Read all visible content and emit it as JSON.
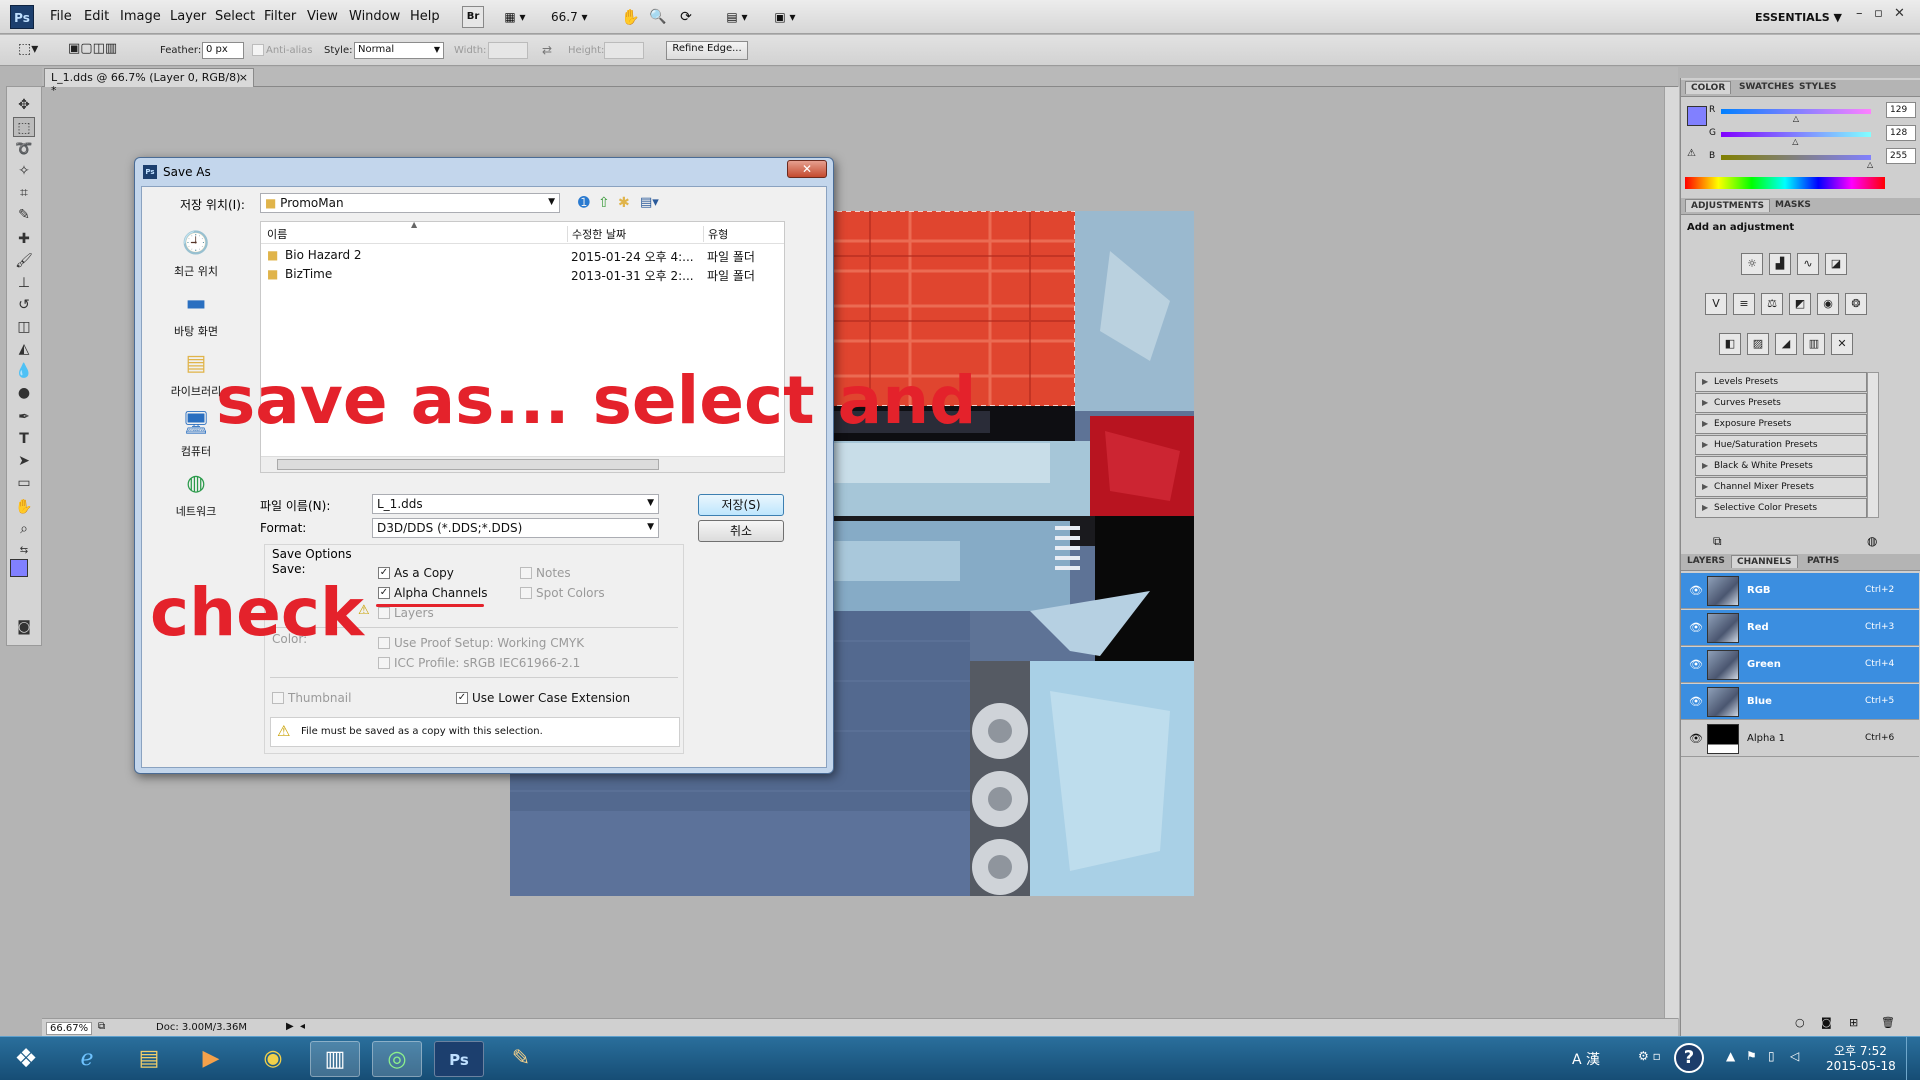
{
  "app": {
    "logo": "Ps",
    "menus": [
      "File",
      "Edit",
      "Image",
      "Layer",
      "Select",
      "Filter",
      "View",
      "Window",
      "Help"
    ],
    "bridge_button": "Br",
    "zoom_value": "66.7",
    "workspace": "ESSENTIALS",
    "workspace_arrow": "▼"
  },
  "options": {
    "feather_label": "Feather:",
    "feather_value": "0 px",
    "antialias_label": "Anti-alias",
    "style_label": "Style:",
    "style_value": "Normal",
    "width_label": "Width:",
    "height_label": "Height:",
    "refine_edge": "Refine Edge..."
  },
  "document": {
    "tab_title": "L_1.dds @ 66.7% (Layer 0, RGB/8) *",
    "tab_close": "×",
    "zoom_status": "66.67%",
    "doc_size": "Doc: 3.00M/3.36M"
  },
  "color_panel": {
    "tabs": [
      "COLOR",
      "SWATCHES",
      "STYLES"
    ],
    "channels": [
      {
        "label": "R",
        "value": "129",
        "level": 0.506
      },
      {
        "label": "G",
        "value": "128",
        "level": 0.502
      },
      {
        "label": "B",
        "value": "255",
        "level": 1.0
      }
    ],
    "fg_color": "#8180ff"
  },
  "adjustments_panel": {
    "tabs": [
      "ADJUSTMENTS",
      "MASKS"
    ],
    "heading": "Add an adjustment",
    "presets": [
      "Levels Presets",
      "Curves Presets",
      "Exposure Presets",
      "Hue/Saturation Presets",
      "Black & White Presets",
      "Channel Mixer Presets",
      "Selective Color Presets"
    ]
  },
  "channels_panel": {
    "tabs": [
      "LAYERS",
      "CHANNELS",
      "PATHS"
    ],
    "rows": [
      {
        "name": "RGB",
        "key": "Ctrl+2",
        "selected": true
      },
      {
        "name": "Red",
        "key": "Ctrl+3",
        "selected": true
      },
      {
        "name": "Green",
        "key": "Ctrl+4",
        "selected": true
      },
      {
        "name": "Blue",
        "key": "Ctrl+5",
        "selected": true
      },
      {
        "name": "Alpha 1",
        "key": "Ctrl+6",
        "selected": false
      }
    ]
  },
  "dialog": {
    "title": "Save As",
    "save_in_label": "저장 위치(I):",
    "save_in_value": "PromoMan",
    "places": [
      "최근 위치",
      "바탕 화면",
      "라이브러리",
      "컴퓨터",
      "네트워크"
    ],
    "columns": [
      "이름",
      "수정한 날짜",
      "유형"
    ],
    "files": [
      {
        "name": "Bio Hazard 2",
        "date": "2015-01-24 오후 4:...",
        "type": "파일 폴더"
      },
      {
        "name": "BizTime",
        "date": "2013-01-31 오후 2:...",
        "type": "파일 폴더"
      }
    ],
    "filename_label": "파일 이름(N):",
    "filename_value": "L_1.dds",
    "format_label": "Format:",
    "format_value": "D3D/DDS (*.DDS;*.DDS)",
    "save_button": "저장(S)",
    "cancel_button": "취소",
    "save_options_label": "Save Options",
    "save_label": "Save:",
    "as_a_copy": "As a Copy",
    "alpha_channels": "Alpha Channels",
    "layers": "Layers",
    "notes": "Notes",
    "spot_colors": "Spot Colors",
    "color_label": "Color:",
    "use_proof": "Use Proof Setup:  Working CMYK",
    "icc_profile": "ICC Profile:  sRGB IEC61966-2.1",
    "thumbnail": "Thumbnail",
    "lower_case": "Use Lower Case Extension",
    "warning": "File must be saved as a copy with this selection."
  },
  "annotations": {
    "top": "save  as...  select  and",
    "bottom": "check"
  },
  "taskbar": {
    "ime": "A 漢",
    "time": "오후 7:52",
    "date": "2015-05-18"
  }
}
